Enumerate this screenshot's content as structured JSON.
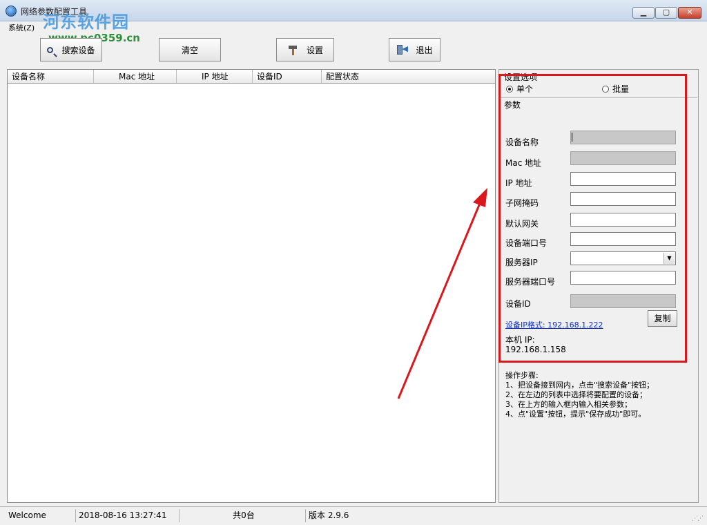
{
  "window": {
    "title": "网络参数配置工具"
  },
  "watermark": {
    "text": "河东软件园",
    "url": "www.pc0359.cn"
  },
  "menu": {
    "label": "系统(Z)"
  },
  "toolbar": {
    "search_label": "搜索设备",
    "clear_label": "清空",
    "set_label": "设置",
    "exit_label": "退出"
  },
  "device_table": {
    "columns": [
      "设备名称",
      "Mac 地址",
      "IP 地址",
      "设备ID",
      "配置状态"
    ],
    "rows": []
  },
  "settings": {
    "title": "设置选项",
    "single_label": "单个",
    "batch_label": "批量",
    "selected": "单个"
  },
  "params": {
    "title": "参数",
    "device_name_label": "设备名称",
    "mac_label": "Mac 地址",
    "ip_label": "IP 地址",
    "subnet_label": "子网掩码",
    "gateway_label": "默认网关",
    "port_label": "设备端口号",
    "server_ip_label": "服务器IP",
    "server_port_label": "服务器端口号",
    "device_id_label": "设备ID",
    "device_name_value": "",
    "mac_value": "",
    "ip_value": "",
    "subnet_value": "",
    "gateway_value": "",
    "port_value": "",
    "server_ip_value": "",
    "server_port_value": "",
    "device_id_value": "",
    "ip_format_link": "设备IP格式: 192.168.1.222",
    "copy_label": "复制",
    "local_ip_label": "本机 IP:",
    "local_ip_value": "192.168.1.158"
  },
  "steps": {
    "title": "操作步骤:",
    "lines": [
      "1、把设备接到网内，点击\"搜索设备\"按钮；",
      "2、在左边的列表中选择将要配置的设备；",
      "3、在上方的输入框内输入相关参数；",
      "4、点\"设置\"按钮，提示\"保存成功\"即可。"
    ]
  },
  "status": {
    "welcome": "Welcome",
    "datetime": "2018-08-16 13:27:41",
    "count": "共0台",
    "version": "版本 2.9.6"
  },
  "colors": {
    "highlight_red": "#d8181c",
    "link_blue": "#0a2ec9"
  },
  "icons": [
    "app-globe-icon",
    "search-icon",
    "hammer-icon",
    "exit-door-icon"
  ]
}
